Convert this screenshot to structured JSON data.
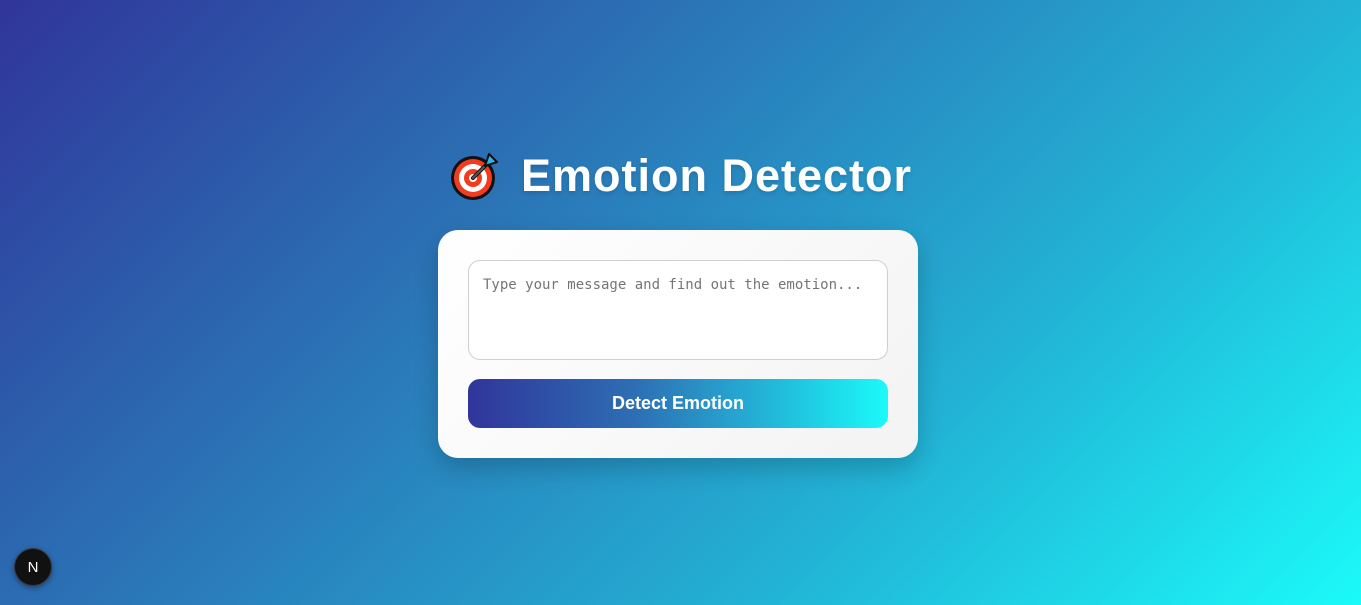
{
  "header": {
    "title": "Emotion Detector",
    "icon": "direct-hit-target-icon"
  },
  "form": {
    "message_placeholder": "Type your message and find out the emotion...",
    "message_value": "",
    "detect_label": "Detect Emotion"
  },
  "dev_badge": {
    "letter": "N",
    "icon": "nextjs-logo-icon"
  },
  "colors": {
    "gradient_start": "#30359a",
    "gradient_end": "#1bfaf9",
    "card_bg": "#ffffff",
    "title_text": "#ffffff"
  }
}
